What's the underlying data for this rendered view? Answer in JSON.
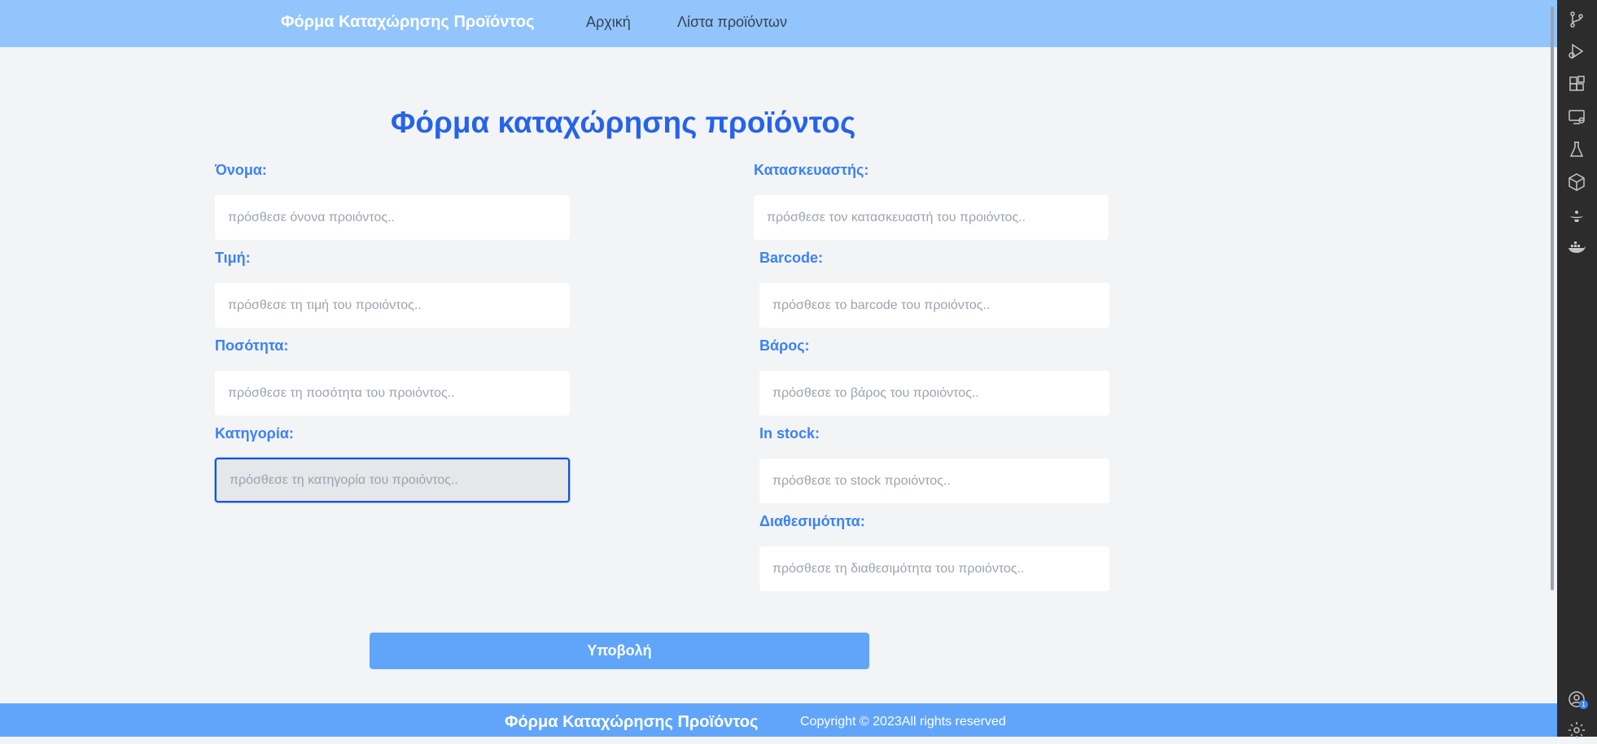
{
  "header": {
    "brand": "Φόρμα Καταχώρησης Προϊόντος",
    "nav": {
      "home": "Αρχική",
      "list": "Λίστα προϊόντων"
    }
  },
  "form": {
    "title": "Φόρμα καταχώρησης προϊόντος",
    "fields": {
      "name": {
        "label": "Όνομα:",
        "placeholder": "πρόσθεσε όνονα προιόντος..",
        "value": ""
      },
      "price": {
        "label": "Τιμή:",
        "placeholder": "πρόσθεσε τη τιμή του προιόντος..",
        "value": ""
      },
      "quantity": {
        "label": "Ποσότητα:",
        "placeholder": "πρόσθεσε τη ποσότητα του προιόντος..",
        "value": ""
      },
      "category": {
        "label": "Κατηγορία:",
        "placeholder": "πρόσθεσε τη κατηγορία του προιόντος..",
        "value": ""
      },
      "manufacturer": {
        "label": "Κατασκευαστής:",
        "placeholder": "πρόσθεσε τον κατασκευαστή του προιόντος..",
        "value": ""
      },
      "barcode": {
        "label": "Barcode:",
        "placeholder": "πρόσθεσε το barcode του προιόντος..",
        "value": ""
      },
      "weight": {
        "label": "Βάρος:",
        "placeholder": "πρόσθεσε το βάρος του προιόντος..",
        "value": ""
      },
      "in_stock": {
        "label": "In stock:",
        "placeholder": "πρόσθεσε το stock προιόντος..",
        "value": ""
      },
      "availability": {
        "label": "Διαθεσιμότητα:",
        "placeholder": "πρόσθεσε τη διαθεσιμότητα του προιόντος..",
        "value": ""
      }
    },
    "submit_label": "Υποβολή"
  },
  "footer": {
    "brand": "Φόρμα Καταχώρησης Προϊόντος",
    "copyright": "Copyright © 2023All rights reserved"
  },
  "activity_bar": {
    "icons": [
      "source-control-icon",
      "run-debug-icon",
      "extensions-icon",
      "remote-explorer-icon",
      "testing-icon",
      "package-icon",
      "lamp-icon",
      "docker-icon",
      "account-icon",
      "settings-gear-icon"
    ],
    "account_badge": "1"
  },
  "colors": {
    "header_bg": "#93c5fd",
    "footer_bg": "#60a5fa",
    "accent": "#2563eb",
    "label": "#3b82f6",
    "button": "#60a5fa"
  }
}
